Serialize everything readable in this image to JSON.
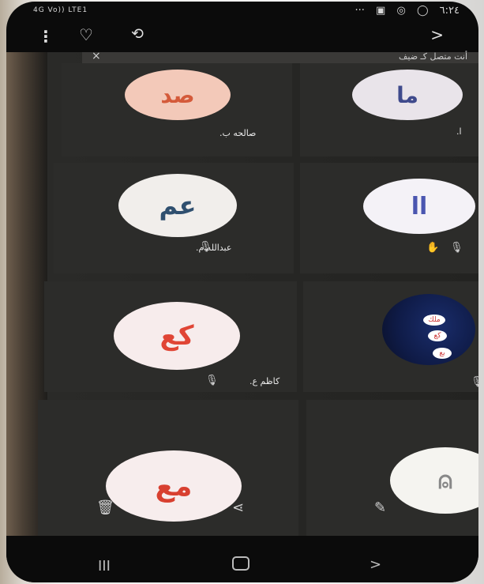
{
  "status_bar": {
    "network": "4G Vo)) LTE1",
    "time": "٦:٢٤",
    "dots": "···"
  },
  "toolbar": {
    "menu_glyph": "⋮",
    "heart_glyph": "♡",
    "repeat_glyph": "⟲",
    "next_glyph": ">"
  },
  "banner": {
    "text": "أنت متصل كـ ضيف",
    "close_glyph": "×"
  },
  "participants": [
    {
      "initials": "ما",
      "name": "ا.",
      "color": "#3f4a8c",
      "bg": "#e9e4ea"
    },
    {
      "initials": "صد",
      "name": "صالحه ب.",
      "color": "#d45a3a",
      "bg": "#f3c9b9"
    },
    {
      "initials": "اا",
      "name": "",
      "color": "#4a56b0",
      "bg": "#f4f2f7"
    },
    {
      "initials": "عم",
      "name": "عبدالله م.",
      "color": "#2f4f6f",
      "bg": "#f1eeeb"
    },
    {
      "initials": "كع",
      "name": "كاظم ع.",
      "color": "#e04535",
      "bg": "#f7ecec"
    },
    {
      "initials": "مع",
      "name": "",
      "color": "#d84030",
      "bg": "#f7eded"
    }
  ],
  "screenshot_bubbles": [
    "ملك",
    "كع",
    "بع"
  ],
  "actions": {
    "trash_glyph": "🗑",
    "share_glyph": "⟨",
    "edit_glyph": "✎"
  },
  "navbar": {
    "recent_glyph": "III",
    "back_glyph": ">"
  }
}
